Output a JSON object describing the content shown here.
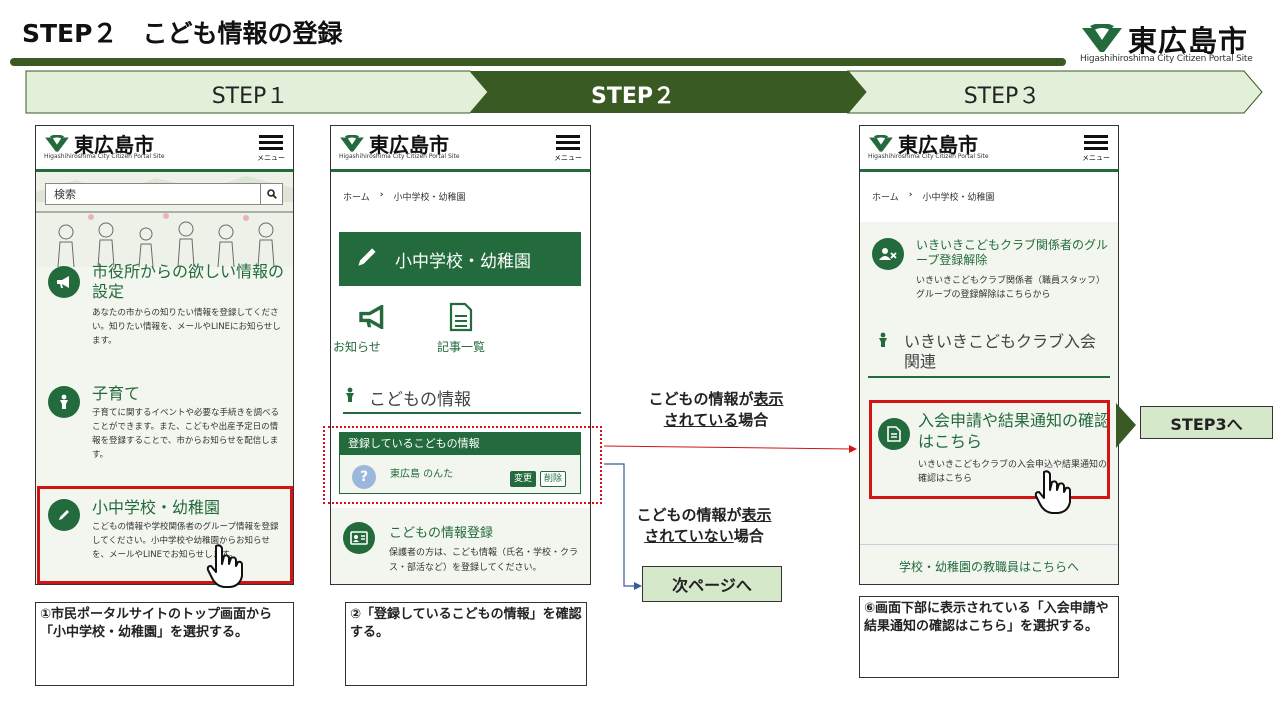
{
  "title": "STEP２　こども情報の登録",
  "brand": {
    "name_jp": "東広島市",
    "name_en": "Higashihiroshima City Citizen Portal Site",
    "color": "#236b3d",
    "dark": "#3a5a23"
  },
  "steps": [
    "STEP１",
    "STEP２",
    "STEP３"
  ],
  "phone_common": {
    "logo_jp": "東広島市",
    "logo_en": "Higashihiroshima City Citizen Portal Site",
    "menu_label": "メニュー"
  },
  "phone1": {
    "search_placeholder": "検索",
    "items": [
      {
        "title": "市役所からの欲しい情報の設定",
        "desc": "あなたの市からの知りたい情報を登録してください。知りたい情報を、メールやLINEにお知らせします。"
      },
      {
        "title": "子育て",
        "desc": "子育てに関するイベントや必要な手続きを調べることができます。また、こどもや出産予定日の情報を登録することで、市からお知らせを配信します。"
      },
      {
        "title": "小中学校・幼稚園",
        "desc": "こどもの情報や学校関係者のグループ情報を登録してください。小中学校や幼稚園からお知らせを、メールやLINEでお知らせします。"
      }
    ]
  },
  "phone2": {
    "breadcrumb_home": "ホーム",
    "breadcrumb_sep": "›",
    "breadcrumb_current": "小中学校・幼稚園",
    "header_title": "小中学校・幼稚園",
    "quick_links": [
      "お知らせ",
      "記事一覧"
    ],
    "section_title": "こどもの情報",
    "registered_header": "登録しているこどもの情報",
    "child_name": "東広島 のんた",
    "edit_label": "変更",
    "delete_label": "削除",
    "register_title": "こどもの情報登録",
    "register_desc": "保護者の方は、こども情報（氏名・学校・クラス・部活など）を登録してください。"
  },
  "phone3": {
    "breadcrumb_home": "ホーム",
    "breadcrumb_sep": "›",
    "breadcrumb_current": "小中学校・幼稚園",
    "item1_title": "いきいきこどもクラブ関係者のグループ登録解除",
    "item1_desc": "いきいきこどもクラブ関係者（職員スタッフ）グループの登録解除はこちらから",
    "section_title": "いきいきこどもクラブ入会関連",
    "item2_title": "入会申請や結果通知の確認はこちら",
    "item2_desc": "いきいきこどもクラブの入会申込や結果通知の確認はこちら",
    "staff_link": "学校・幼稚園の教職員はこちらへ"
  },
  "callouts": {
    "shown_prefix": "こどもの情報が",
    "shown_u": "表示",
    "shown_u2": "されている",
    "shown_suffix": "場合",
    "notshown_prefix": "こどもの情報が",
    "notshown_u": "表示",
    "notshown_u2": "されていない",
    "notshown_suffix": "場合",
    "next_page": "次ページへ",
    "to_step3": "STEP3へ"
  },
  "notes": [
    "①市民ポータルサイトのトップ画面から「小中学校・幼稚園」を選択する。",
    "②「登録しているこどもの情報」を確認する。",
    "⑥画面下部に表示されている「入会申請や結果通知の確認はこちら」を選択する。"
  ]
}
